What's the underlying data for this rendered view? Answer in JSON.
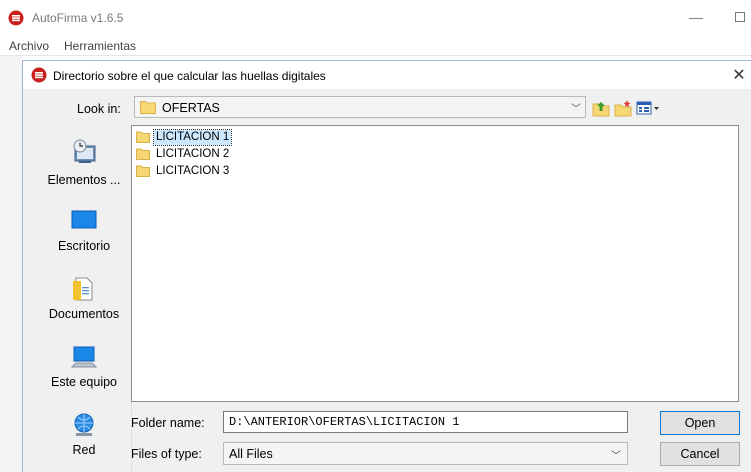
{
  "app": {
    "title": "AutoFirma v1.6.5",
    "menu": [
      "Archivo",
      "Herramientas"
    ],
    "minimize_glyph": "—"
  },
  "dialog": {
    "title": "Directorio sobre el que calcular las huellas digitales",
    "close_glyph": "✕",
    "look_in_label": "Look in:",
    "look_in_value": "OFERTAS",
    "places": [
      {
        "label": "Elementos ...",
        "icon": "recent-items-icon"
      },
      {
        "label": "Escritorio",
        "icon": "desktop-icon"
      },
      {
        "label": "Documentos",
        "icon": "documents-icon"
      },
      {
        "label": "Este equipo",
        "icon": "computer-icon"
      },
      {
        "label": "Red",
        "icon": "network-icon"
      }
    ],
    "files": [
      {
        "name": "LICITACION 1",
        "selected": true
      },
      {
        "name": "LICITACION 2",
        "selected": false
      },
      {
        "name": "LICITACION 3",
        "selected": false
      }
    ],
    "folder_name_label": "Folder name:",
    "folder_name_value": "D:\\ANTERIOR\\OFERTAS\\LICITACION 1",
    "files_type_label": "Files of type:",
    "files_type_value": "All Files",
    "open_label": "Open",
    "cancel_label": "Cancel"
  },
  "colors": {
    "accent": "#0078d7",
    "selection": "#cce8ff",
    "folder": "#f7d774",
    "brand_red": "#c8201c"
  }
}
